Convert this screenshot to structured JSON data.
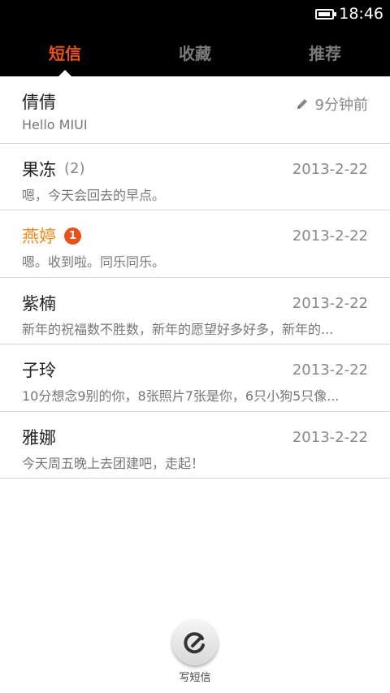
{
  "status_bar": {
    "time": "18:46",
    "battery_level": 0.7
  },
  "tabs": [
    {
      "label": "短信",
      "active": true
    },
    {
      "label": "收藏",
      "active": false
    },
    {
      "label": "推荐",
      "active": false
    }
  ],
  "conversations": [
    {
      "name": "倩倩",
      "count": "",
      "badge": "",
      "time": "9分钟前",
      "draft": true,
      "preview": "Hello MIUI"
    },
    {
      "name": "果冻",
      "count": "(2)",
      "badge": "",
      "time": "2013-2-22",
      "draft": false,
      "preview": "嗯，今天会回去的早点。"
    },
    {
      "name": "燕婷",
      "count": "",
      "badge": "1",
      "time": "2013-2-22",
      "draft": false,
      "preview": "嗯。收到啦。同乐同乐。"
    },
    {
      "name": "紫楠",
      "count": "",
      "badge": "",
      "time": "2013-2-22",
      "draft": false,
      "preview": "新年的祝福数不胜数，新年的愿望好多好多，新年的..."
    },
    {
      "name": "子玲",
      "count": "",
      "badge": "",
      "time": "2013-2-22",
      "draft": false,
      "preview": "10分想念9别的你，8张照片7张是你，6只小狗5只像..."
    },
    {
      "name": "雅娜",
      "count": "",
      "badge": "",
      "time": "2013-2-22",
      "draft": false,
      "preview": "今天周五晚上去团建吧，走起！"
    }
  ],
  "compose": {
    "label": "写短信"
  },
  "colors": {
    "accent": "#e8511b",
    "unread_name": "#f08a1e"
  }
}
